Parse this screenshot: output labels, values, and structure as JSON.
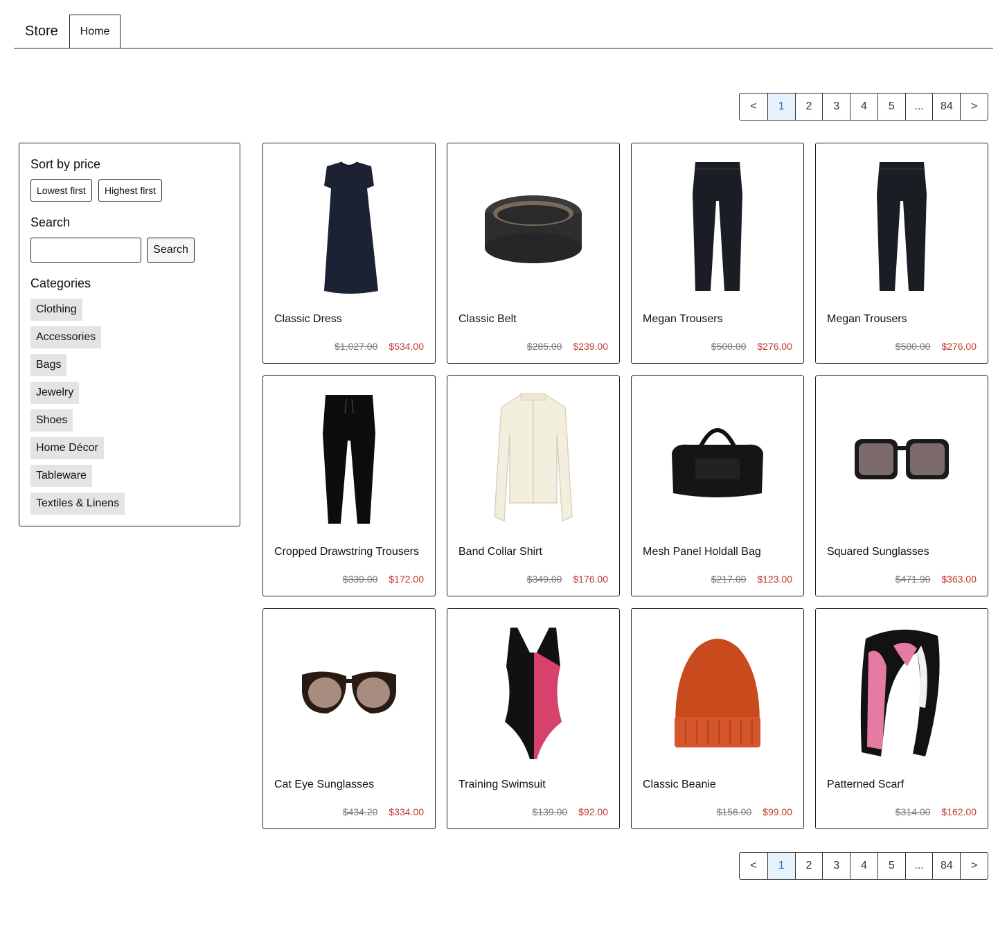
{
  "header": {
    "brand": "Store",
    "tab_home": "Home"
  },
  "pagination": {
    "prev": "<",
    "next": ">",
    "pages": [
      "1",
      "2",
      "3",
      "4",
      "5",
      "...",
      "84"
    ],
    "active": "1"
  },
  "sidebar": {
    "sort_heading": "Sort by price",
    "sort_lowest": "Lowest first",
    "sort_highest": "Highest first",
    "search_heading": "Search",
    "search_value": "",
    "search_button": "Search",
    "categories_heading": "Categories",
    "categories": [
      "Clothing",
      "Accessories",
      "Bags",
      "Jewelry",
      "Shoes",
      "Home Décor",
      "Tableware",
      "Textiles & Linens"
    ]
  },
  "products": [
    {
      "name": "Classic Dress",
      "old_price": "$1,027.00",
      "price": "$534.00",
      "icon": "dress-icon"
    },
    {
      "name": "Classic Belt",
      "old_price": "$285.00",
      "price": "$239.00",
      "icon": "belt-icon"
    },
    {
      "name": "Megan Trousers",
      "old_price": "$500.00",
      "price": "$276.00",
      "icon": "trousers-icon"
    },
    {
      "name": "Megan Trousers",
      "old_price": "$500.00",
      "price": "$276.00",
      "icon": "trousers-icon"
    },
    {
      "name": "Cropped Drawstring Trousers",
      "old_price": "$339.00",
      "price": "$172.00",
      "icon": "trousers-icon"
    },
    {
      "name": "Band Collar Shirt",
      "old_price": "$349.00",
      "price": "$176.00",
      "icon": "shirt-icon"
    },
    {
      "name": "Mesh Panel Holdall Bag",
      "old_price": "$217.00",
      "price": "$123.00",
      "icon": "bag-icon"
    },
    {
      "name": "Squared Sunglasses",
      "old_price": "$471.90",
      "price": "$363.00",
      "icon": "sunglasses-icon"
    },
    {
      "name": "Cat Eye Sunglasses",
      "old_price": "$434.20",
      "price": "$334.00",
      "icon": "sunglasses-icon"
    },
    {
      "name": "Training Swimsuit",
      "old_price": "$139.00",
      "price": "$92.00",
      "icon": "swimsuit-icon"
    },
    {
      "name": "Classic Beanie",
      "old_price": "$156.00",
      "price": "$99.00",
      "icon": "beanie-icon"
    },
    {
      "name": "Patterned Scarf",
      "old_price": "$314.00",
      "price": "$162.00",
      "icon": "scarf-icon"
    }
  ]
}
